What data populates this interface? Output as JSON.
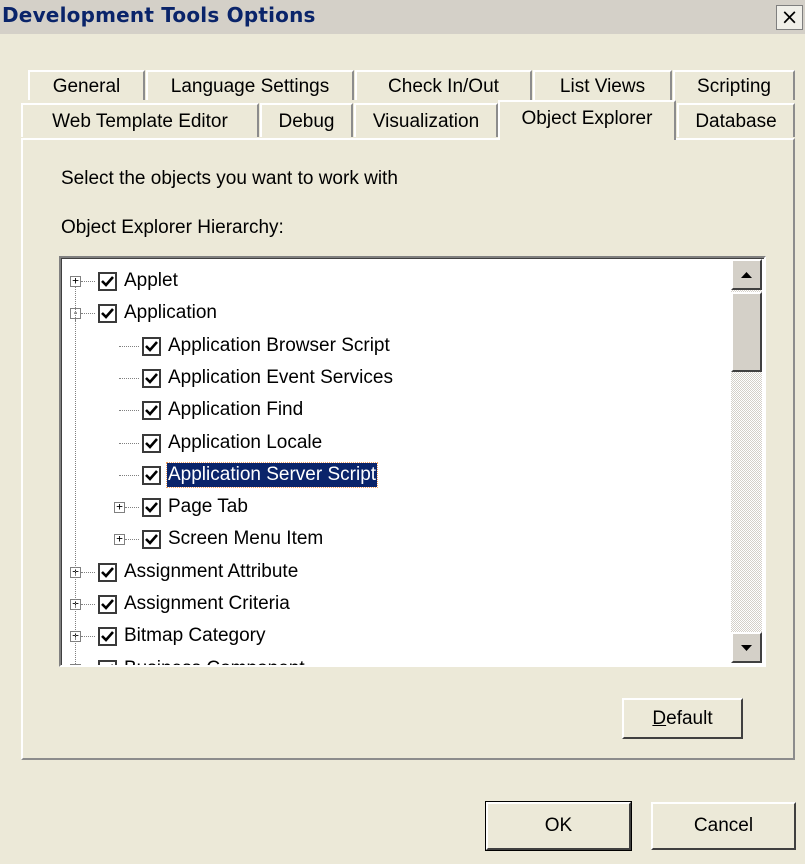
{
  "window": {
    "title": "Development Tools Options",
    "close_glyph": "×",
    "icons": {
      "close": "close-icon",
      "check": "check-icon",
      "expand": "plus-icon",
      "collapse": "minus-icon"
    }
  },
  "tabs": {
    "row1": [
      "General",
      "Language Settings",
      "Check In/Out",
      "List Views",
      "Scripting"
    ],
    "row2": [
      "Web Template Editor",
      "Debug",
      "Visualization",
      "Object Explorer",
      "Database"
    ],
    "active": "Object Explorer"
  },
  "panel": {
    "instruction": "Select the objects you want to work with",
    "hierarchy_label": "Object Explorer Hierarchy:"
  },
  "tree": {
    "items": [
      {
        "label": "Applet",
        "level": 0,
        "expander": "+",
        "checked": true
      },
      {
        "label": "Application",
        "level": 0,
        "expander": "−",
        "checked": true
      },
      {
        "label": "Application Browser Script",
        "level": 1,
        "expander": "",
        "checked": true
      },
      {
        "label": "Application Event Services",
        "level": 1,
        "expander": "",
        "checked": true
      },
      {
        "label": "Application Find",
        "level": 1,
        "expander": "",
        "checked": true
      },
      {
        "label": "Application Locale",
        "level": 1,
        "expander": "",
        "checked": true
      },
      {
        "label": "Application Server Script",
        "level": 1,
        "expander": "",
        "checked": true,
        "selected": true
      },
      {
        "label": "Page Tab",
        "level": 1,
        "expander": "+",
        "checked": true
      },
      {
        "label": "Screen Menu Item",
        "level": 1,
        "expander": "+",
        "checked": true
      },
      {
        "label": "Assignment Attribute",
        "level": 0,
        "expander": "+",
        "checked": true
      },
      {
        "label": "Assignment Criteria",
        "level": 0,
        "expander": "+",
        "checked": true
      },
      {
        "label": "Bitmap Category",
        "level": 0,
        "expander": "+",
        "checked": true
      },
      {
        "label": "Business Component",
        "level": 0,
        "expander": "+",
        "checked": true
      }
    ],
    "selection_color": "#0a246a"
  },
  "buttons": {
    "default_label": "Default",
    "default_mnemonic": "D",
    "default_rest": "efault",
    "ok_label": "OK",
    "cancel_label": "Cancel"
  }
}
